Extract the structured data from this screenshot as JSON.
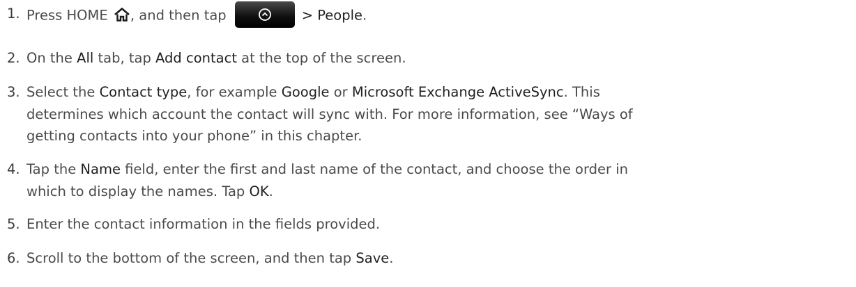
{
  "steps": [
    {
      "number": "1.",
      "parts": {
        "a": "Press HOME ",
        "b": ", and then tap",
        "c": "> People",
        "c_suffix": "."
      },
      "icons": [
        "home-icon",
        "app-launcher-icon"
      ]
    },
    {
      "number": "2.",
      "parts": {
        "a": "On the ",
        "b": "All",
        "c": " tab, tap ",
        "d": "Add contact",
        "e": " at the top of the screen."
      }
    },
    {
      "number": "3.",
      "lines": [
        {
          "a": "Select the ",
          "b": "Contact type",
          "c": ", for example ",
          "d": "Google",
          "e": " or ",
          "f": "Microsoft Exchange ActiveSync",
          "g": ". This"
        },
        {
          "a": "determines which account the contact will sync with. For more information, see “Ways of"
        },
        {
          "a": "getting contacts into your phone” in this chapter."
        }
      ]
    },
    {
      "number": "4.",
      "lines": [
        {
          "a": "Tap the ",
          "b": "Name",
          "c": " field, enter the first and last name of the contact, and choose the order in"
        },
        {
          "a": "which to display the names. Tap ",
          "b": "OK",
          "c": "."
        }
      ]
    },
    {
      "number": "5.",
      "parts": {
        "a": "Enter the contact information in the fields provided."
      }
    },
    {
      "number": "6.",
      "parts": {
        "a": "Scroll to the bottom of the screen, and then tap ",
        "b": "Save",
        "c": "."
      }
    }
  ],
  "colors": {
    "text": "#4a4a4a",
    "emphasis": "#1f1f1f",
    "button": "#111111"
  }
}
